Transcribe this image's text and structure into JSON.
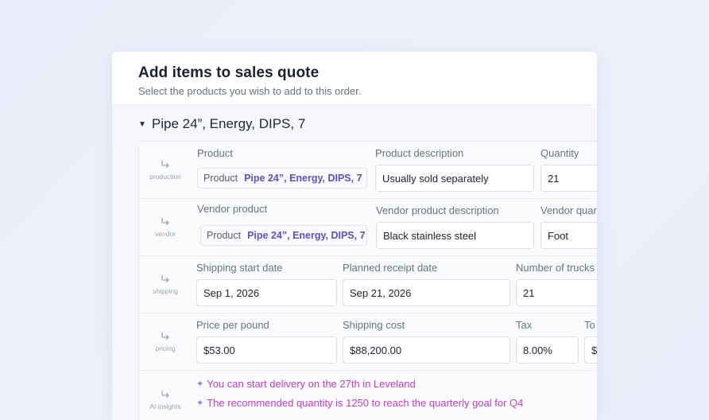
{
  "dialog": {
    "title": "Add items to sales quote",
    "subtitle": "Select the products you wish to add to this order."
  },
  "group": {
    "title": "Pipe 24”, Energy, DIPS, 7",
    "expanded": true
  },
  "rows": {
    "production": {
      "icon_label": "production",
      "product_label": "Product",
      "product_chip_key": "Product",
      "product_chip_value": "Pipe 24”, Energy, DIPS, 7",
      "description_label": "Product description",
      "description_value": "Usually sold separately",
      "quantity_label": "Quantity",
      "quantity_value": "21"
    },
    "vendor": {
      "icon_label": "vendor",
      "vendor_product_label": "Vendor product",
      "vendor_chip_key": "Product",
      "vendor_chip_value": "Pipe 24”, Energy, DIPS, 7",
      "vendor_description_label": "Vendor product description",
      "vendor_description_value": "Black stainless steel",
      "vendor_quantity_label": "Vendor quan",
      "vendor_quantity_value": "Foot"
    },
    "shipping": {
      "icon_label": "shipping",
      "start_label": "Shipping start date",
      "start_value": "Sep 1, 2026",
      "receipt_label": "Planned receipt date",
      "receipt_value": "Sep 21, 2026",
      "trucks_label": "Number of trucks",
      "trucks_value": "21"
    },
    "pricing": {
      "icon_label": "pricing",
      "price_label": "Price per pound",
      "price_value": "$53.00",
      "shipping_cost_label": "Shipping cost",
      "shipping_cost_value": "$88,200.00",
      "tax_label": "Tax",
      "tax_value": "8.00%",
      "total_label": "To",
      "total_value": "$"
    },
    "insights": {
      "icon_label": "AI insights",
      "items": [
        "You can start delivery on the 27th in Leveland",
        "The recommended quantity is 1250 to reach the quarterly goal for Q4"
      ]
    }
  },
  "colors": {
    "accent": "#5b4fd0",
    "insight": "#c03dc6"
  }
}
